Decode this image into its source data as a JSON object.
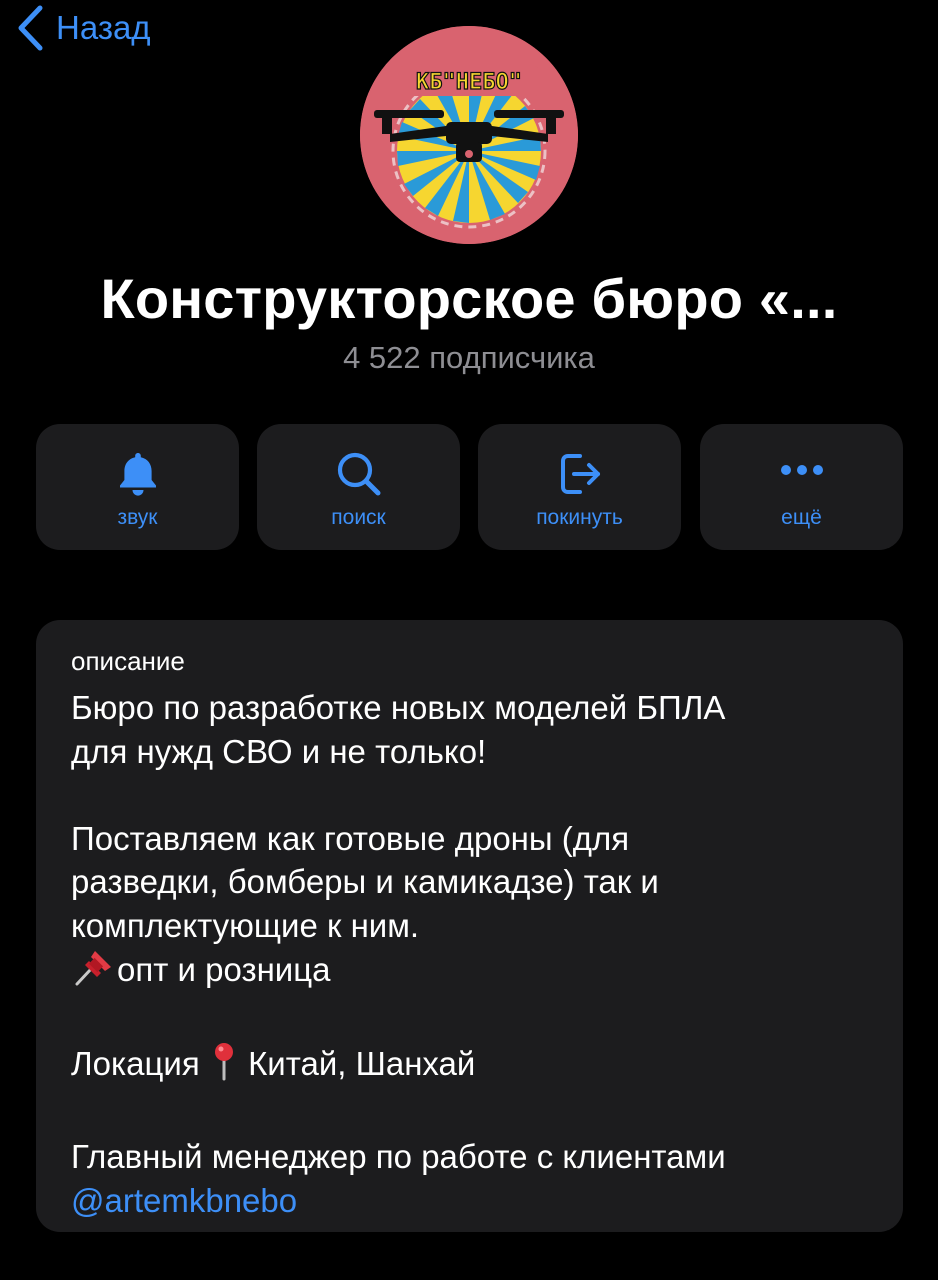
{
  "nav": {
    "back_label": "Назад"
  },
  "channel": {
    "avatar_text": "КБ\"НЕБО\"",
    "title": "Конструкторское бюро «...",
    "subscribers": "4 522 подписчика"
  },
  "actions": [
    {
      "label": "звук",
      "icon": "bell-icon"
    },
    {
      "label": "поиск",
      "icon": "search-icon"
    },
    {
      "label": "покинуть",
      "icon": "leave-icon"
    },
    {
      "label": "ещё",
      "icon": "more-icon"
    }
  ],
  "description": {
    "label": "описание",
    "line1": "Бюро по разработке новых моделей БПЛА",
    "line2": "для нужд СВО и не только!",
    "line3": "Поставляем как готовые дроны (для",
    "line4": "разведки, бомберы и камикадзе) так и",
    "line5": "комплектующие к ним.",
    "line6": "опт и розница",
    "line7a": "Локация",
    "line7b": "Китай, Шанхай",
    "line8": "Главный менеджер по работе с клиентами",
    "link": "@artemkbnebo"
  },
  "colors": {
    "accent": "#3d8ff7",
    "card": "#1c1c1e",
    "muted": "#8e8e93",
    "background": "#000000"
  }
}
